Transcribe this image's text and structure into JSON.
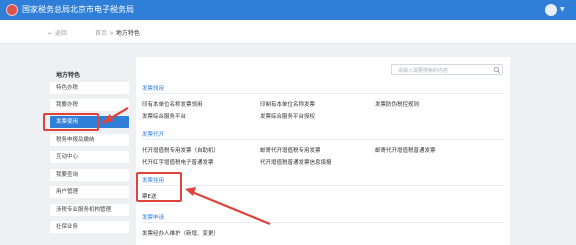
{
  "header": {
    "title": "国家税务总局北京市电子税务局",
    "accent": "#2f7fd8"
  },
  "breadcrumb": {
    "back_label": "← 返回",
    "home": "首页",
    "sep": ">",
    "current": "地方特色"
  },
  "sidebar": {
    "title": "地方特色",
    "items": [
      {
        "label": "特色办税",
        "active": false
      },
      {
        "label": "我要办税",
        "active": false
      },
      {
        "label": "发票使用",
        "active": true
      },
      {
        "label": "税务申报及缴纳",
        "active": false
      },
      {
        "label": "互动中心",
        "active": false
      },
      {
        "label": "我要查询",
        "active": false
      },
      {
        "label": "用户管理",
        "active": false
      },
      {
        "label": "涉税专业服务机构管理",
        "active": false
      },
      {
        "label": "社保业务",
        "active": false
      }
    ]
  },
  "search": {
    "placeholder": "请输入需要搜索的内容"
  },
  "sections": [
    {
      "title": "发票领用",
      "links": [
        "印有本单位名称发票领用",
        "印制有本单位名称发票",
        "发票防伪税控规则",
        "发票综合服务平台",
        "发票综合服务平台授权"
      ]
    },
    {
      "title": "发票代开",
      "links": [
        "代开增值税专用发票（自助机）",
        "邮寄代开增值税专用发票",
        "邮寄代开增值税普通发票",
        "代开红字增值税电子普通发票",
        "代开增值税普通发票信息填报"
      ]
    },
    {
      "title": "发票挂用",
      "links": [
        "票E送"
      ]
    },
    {
      "title": "发票申请",
      "links": [
        "发票经办人维护（新增、变更）"
      ]
    }
  ],
  "annotation_color": "#e0433a"
}
